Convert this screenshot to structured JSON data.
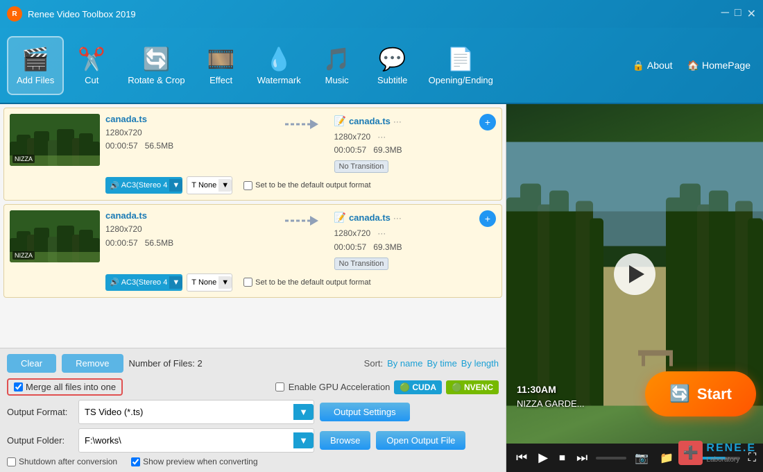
{
  "app": {
    "title": "Renee Video Toolbox 2019",
    "logo_letter": "R"
  },
  "window_controls": {
    "minimize": "─",
    "maximize": "□",
    "close": "✕"
  },
  "toolbar": {
    "items": [
      {
        "id": "add-files",
        "label": "Add Files",
        "icon": "🎬"
      },
      {
        "id": "cut",
        "label": "Cut",
        "icon": "✂️"
      },
      {
        "id": "rotate-crop",
        "label": "Rotate & Crop",
        "icon": "⬜"
      },
      {
        "id": "effect",
        "label": "Effect",
        "icon": "🎞"
      },
      {
        "id": "watermark",
        "label": "Watermark",
        "icon": "💧"
      },
      {
        "id": "music",
        "label": "Music",
        "icon": "🎵"
      },
      {
        "id": "subtitle",
        "label": "Subtitle",
        "icon": "💬"
      },
      {
        "id": "opening-ending",
        "label": "Opening/Ending",
        "icon": "📄"
      }
    ],
    "about_label": "About",
    "homepage_label": "HomePage"
  },
  "file_list": {
    "items": [
      {
        "filename": "canada.ts",
        "resolution": "1280x720",
        "duration": "00:00:57",
        "size": "56.5MB",
        "output_filename": "canada.ts",
        "output_resolution": "1280x720",
        "output_duration": "00:00:57",
        "output_size": "69.3MB",
        "transition": "No Transition",
        "audio_track": "AC3(Stereo 4",
        "subtitle_track": "None"
      },
      {
        "filename": "canada.ts",
        "resolution": "1280x720",
        "duration": "00:00:57",
        "size": "56.5MB",
        "output_filename": "canada.ts",
        "output_resolution": "1280x720",
        "output_duration": "00:00:57",
        "output_size": "69.3MB",
        "transition": "No Transition",
        "audio_track": "AC3(Stereo 4",
        "subtitle_track": "None"
      }
    ]
  },
  "bottom_controls": {
    "clear_label": "Clear",
    "remove_label": "Remove",
    "file_count_prefix": "Number of Files:",
    "file_count": "2",
    "sort_label": "Sort:",
    "sort_by_name": "By name",
    "sort_by_time": "By time",
    "sort_by_length": "By length",
    "merge_label": "Merge all files into one",
    "gpu_label": "Enable GPU Acceleration",
    "cuda_label": "CUDA",
    "nvenc_label": "NVENC",
    "output_format_label": "Output Format:",
    "output_format_value": "TS Video (*.ts)",
    "output_settings_label": "Output Settings",
    "output_folder_label": "Output Folder:",
    "output_folder_value": "F:\\works\\",
    "browse_label": "Browse",
    "open_output_label": "Open Output File",
    "shutdown_label": "Shutdown after conversion",
    "show_preview_label": "Show preview when converting",
    "default_format_label": "Set to be the default output format"
  },
  "video_preview": {
    "timestamp": "11:30AM",
    "location": "NIZZA GARDE..."
  },
  "start_button": {
    "label": "Start"
  }
}
